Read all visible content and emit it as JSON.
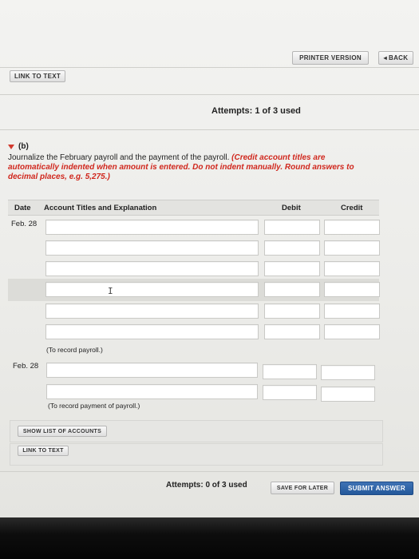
{
  "toolbar": {
    "printer_version": "PRINTER VERSION",
    "back": "BACK",
    "back_icon": "◂"
  },
  "top_link": "LINK TO TEXT",
  "attempts_top": "Attempts: 1 of 3 used",
  "part": {
    "label": "(b)",
    "instruction_plain": "Journalize the February payroll and the payment of the payroll. ",
    "instruction_red_1": "(Credit account titles are",
    "instruction_red_2": "automatically indented when amount is entered. Do not indent manually. Round answers to",
    "instruction_red_3": "decimal places, e.g. 5,275.)"
  },
  "table": {
    "headers": {
      "date": "Date",
      "account": "Account Titles and Explanation",
      "debit": "Debit",
      "credit": "Credit"
    },
    "entry1": {
      "date": "Feb. 28",
      "caption": "(To record payroll.)",
      "rows": [
        "",
        "",
        "",
        "",
        "",
        ""
      ]
    },
    "entry2": {
      "date": "Feb. 28",
      "caption": "(To record payment of payroll.)",
      "rows": [
        "",
        ""
      ]
    }
  },
  "show_accounts": "SHOW LIST OF ACCOUNTS",
  "bottom_link": "LINK TO TEXT",
  "attempts_bottom": "Attempts: 0 of 3 used",
  "save_later": "SAVE FOR LATER",
  "submit": "SUBMIT ANSWER",
  "colors": {
    "accent_red": "#d0271d",
    "primary_blue": "#2d62a6"
  }
}
